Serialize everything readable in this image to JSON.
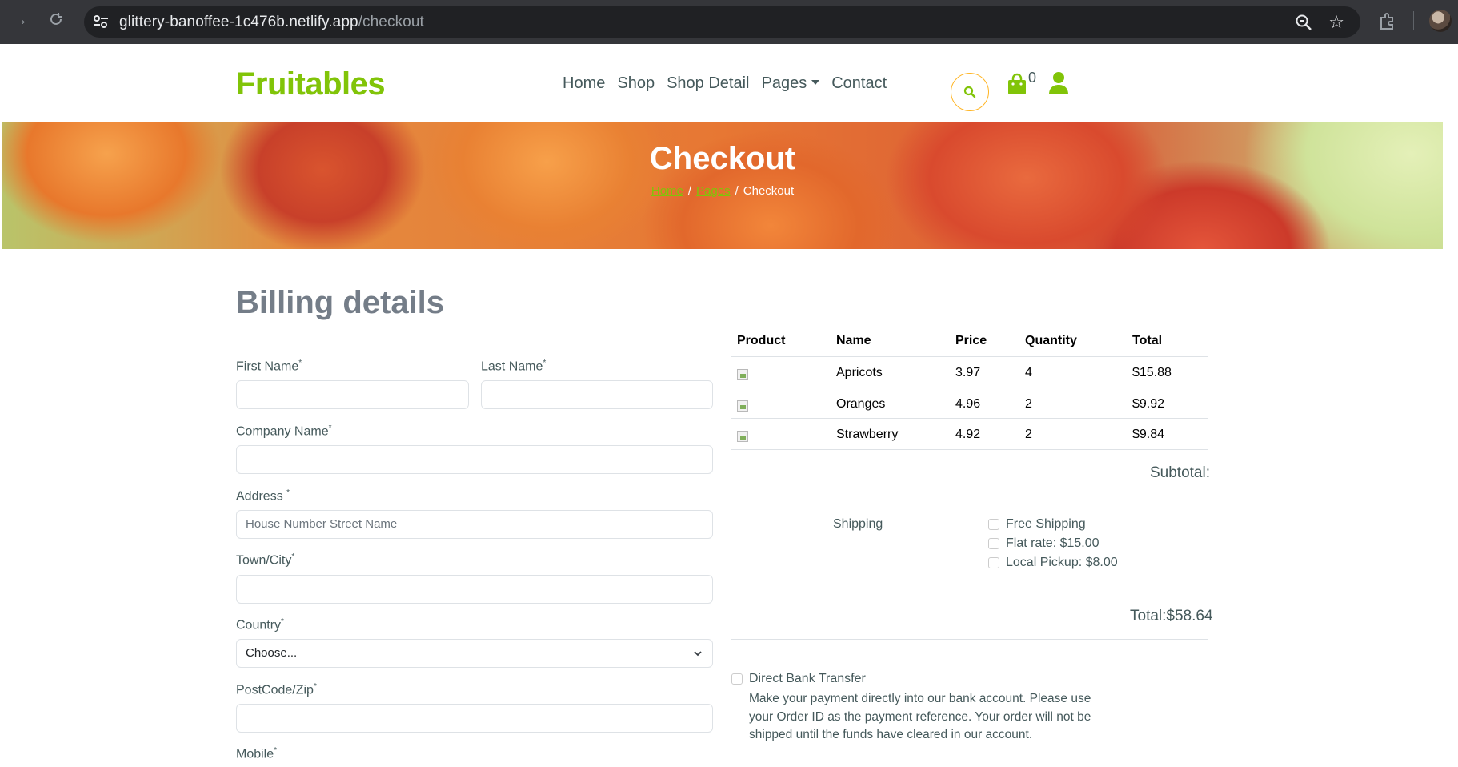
{
  "browser": {
    "url_host": "glittery-banoffee-1c476b.netlify.app",
    "url_path": "/checkout"
  },
  "header": {
    "logo": "Fruitables",
    "nav": [
      {
        "label": "Home"
      },
      {
        "label": "Shop"
      },
      {
        "label": "Shop Detail"
      },
      {
        "label": "Pages"
      },
      {
        "label": "Contact"
      }
    ],
    "cart_count": "0"
  },
  "hero": {
    "title": "Checkout",
    "breadcrumb": [
      "Home",
      "Pages",
      "Checkout"
    ],
    "separator": "/"
  },
  "billing": {
    "title": "Billing details",
    "first_name_label": "First Name",
    "last_name_label": "Last Name",
    "company_label": "Company Name",
    "address_label": "Address ",
    "address_placeholder": "House Number Street Name",
    "town_label": "Town/City",
    "country_label": "Country",
    "country_value": "Choose...",
    "postcode_label": "PostCode/Zip",
    "mobile_label": "Mobile",
    "required_mark": "*"
  },
  "order": {
    "columns": [
      "Product",
      "Name",
      "Price",
      "Quantity",
      "Total"
    ],
    "rows": [
      {
        "name": "Apricots",
        "price": "3.97",
        "quantity": "4",
        "total": "$15.88"
      },
      {
        "name": "Oranges",
        "price": "4.96",
        "quantity": "2",
        "total": "$9.92"
      },
      {
        "name": "Strawberry",
        "price": "4.92",
        "quantity": "2",
        "total": "$9.84"
      }
    ],
    "subtotal_label": "Subtotal:",
    "shipping_label": "Shipping",
    "shipping_options": [
      "Free Shipping",
      "Flat rate: $15.00",
      "Local Pickup: $8.00"
    ],
    "total_label": "Total:$58.64",
    "payment_title": "Direct Bank Transfer",
    "payment_desc": "Make your payment directly into our bank account. Please use your Order ID as the payment reference. Your order will not be shipped until the funds have cleared in our account."
  },
  "colors": {
    "brand_green": "#81c408",
    "accent_yellow": "#ffb524",
    "text": "#45595b"
  }
}
